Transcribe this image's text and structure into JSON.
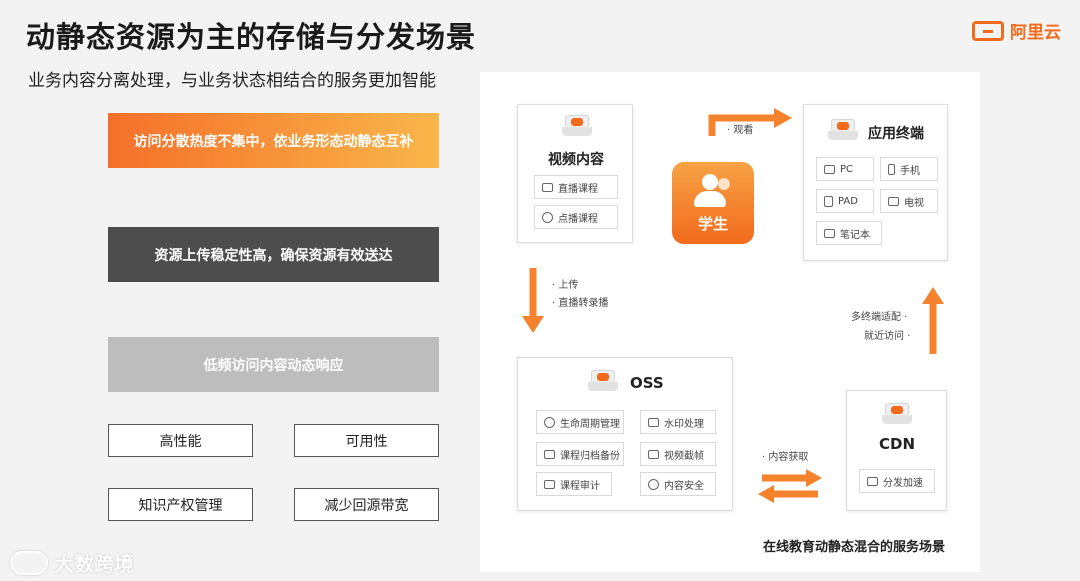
{
  "header": {
    "title": "动静态资源为主的存储与分发场景",
    "subtitle": "业务内容分离处理，与业务状态相结合的服务更加智能",
    "logo_text": "阿里云"
  },
  "left": {
    "bars": [
      {
        "label": "访问分散热度不集中，依业务形态动静态互补"
      },
      {
        "label": "资源上传稳定性高，确保资源有效送达"
      },
      {
        "label": "低频访问内容动态响应"
      }
    ],
    "features": [
      "高性能",
      "可用性",
      "知识产权管理",
      "减少回源带宽"
    ]
  },
  "diagram": {
    "video": {
      "title": "视频内容",
      "items": [
        "直播课程",
        "点播课程"
      ]
    },
    "terminal": {
      "title": "应用终端",
      "items": [
        "PC",
        "手机",
        "PAD",
        "电视",
        "笔记本"
      ]
    },
    "student": {
      "label": "学生"
    },
    "oss": {
      "title": "OSS",
      "items": [
        "生命周期管理",
        "水印处理",
        "课程归档备份",
        "视频截帧",
        "课程审计",
        "内容安全"
      ]
    },
    "cdn": {
      "title": "CDN",
      "items": [
        "分发加速"
      ]
    },
    "flows": {
      "watch": "· 观看",
      "upload": "· 上传",
      "transcode": "· 直播转录播",
      "multi_adapt": "多终端适配 ·",
      "nearby": "就近访问 ·",
      "fetch": "· 内容获取"
    },
    "caption": "在线教育动静态混合的服务场景"
  },
  "watermark": {
    "text": "大数跨境"
  },
  "colors": {
    "accent": "#f26b1d",
    "dark_bar": "#4d4d4d",
    "light_bar": "#bdbdbd"
  }
}
